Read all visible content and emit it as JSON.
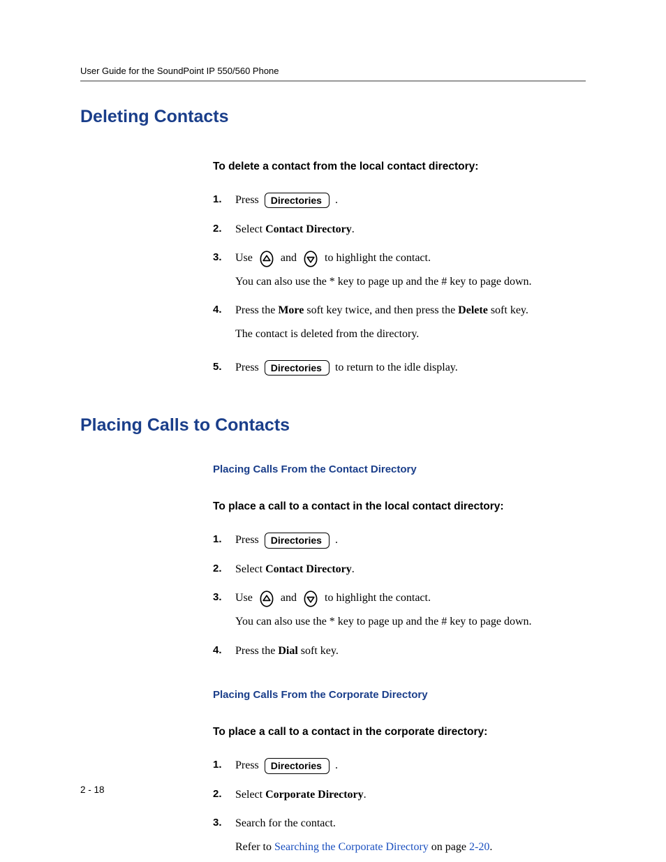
{
  "header": "User Guide for the SoundPoint IP 550/560 Phone",
  "page_number": "2 - 18",
  "key_labels": {
    "directories": "Directories"
  },
  "sections": [
    {
      "title": "Deleting Contacts",
      "blocks": [
        {
          "sub_heading": "To delete a contact from the local contact directory:",
          "steps": [
            {
              "n": 1,
              "pre": "Press ",
              "key": "directories",
              "post": " ."
            },
            {
              "n": 2,
              "text_parts": [
                "Select ",
                {
                  "b": "Contact Directory"
                },
                "."
              ]
            },
            {
              "n": 3,
              "text_parts": [
                "Use ",
                {
                  "arrow": "up"
                },
                " and ",
                {
                  "arrow": "down"
                },
                " to highlight the contact."
              ],
              "sub": "You can also use the * key to page up and the # key to page down."
            },
            {
              "n": 4,
              "text_parts": [
                "Press the ",
                {
                  "b": "More"
                },
                " soft key twice, and then press the ",
                {
                  "b": "Delete"
                },
                " soft key."
              ],
              "sub": "The contact is deleted from the directory."
            },
            {
              "n": 5,
              "pre": "Press ",
              "key": "directories",
              "post": " to return to the idle display."
            }
          ]
        }
      ]
    },
    {
      "title": "Placing Calls to Contacts",
      "blocks": [
        {
          "blue_heading": "Placing Calls From the Contact Directory",
          "sub_heading": "To place a call to a contact in the local contact directory:",
          "steps": [
            {
              "n": 1,
              "pre": "Press ",
              "key": "directories",
              "post": " ."
            },
            {
              "n": 2,
              "text_parts": [
                "Select ",
                {
                  "b": "Contact Directory"
                },
                "."
              ]
            },
            {
              "n": 3,
              "text_parts": [
                "Use ",
                {
                  "arrow": "up"
                },
                " and ",
                {
                  "arrow": "down"
                },
                " to highlight the contact."
              ],
              "sub": "You can also use the * key to page up and the # key to page down."
            },
            {
              "n": 4,
              "text_parts": [
                "Press the ",
                {
                  "b": "Dial"
                },
                " soft key."
              ]
            }
          ]
        },
        {
          "blue_heading": "Placing Calls From the Corporate Directory",
          "sub_heading": "To place a call to a contact in the corporate directory:",
          "steps": [
            {
              "n": 1,
              "pre": "Press ",
              "key": "directories",
              "post": " ."
            },
            {
              "n": 2,
              "text_parts": [
                "Select ",
                {
                  "b": "Corporate Directory"
                },
                "."
              ]
            },
            {
              "n": 3,
              "text_parts": [
                "Search for the contact."
              ],
              "sub_parts": [
                "Refer to ",
                {
                  "link": "Searching the Corporate Directory"
                },
                " on page ",
                {
                  "link": "2-20"
                },
                "."
              ]
            }
          ]
        }
      ]
    }
  ]
}
